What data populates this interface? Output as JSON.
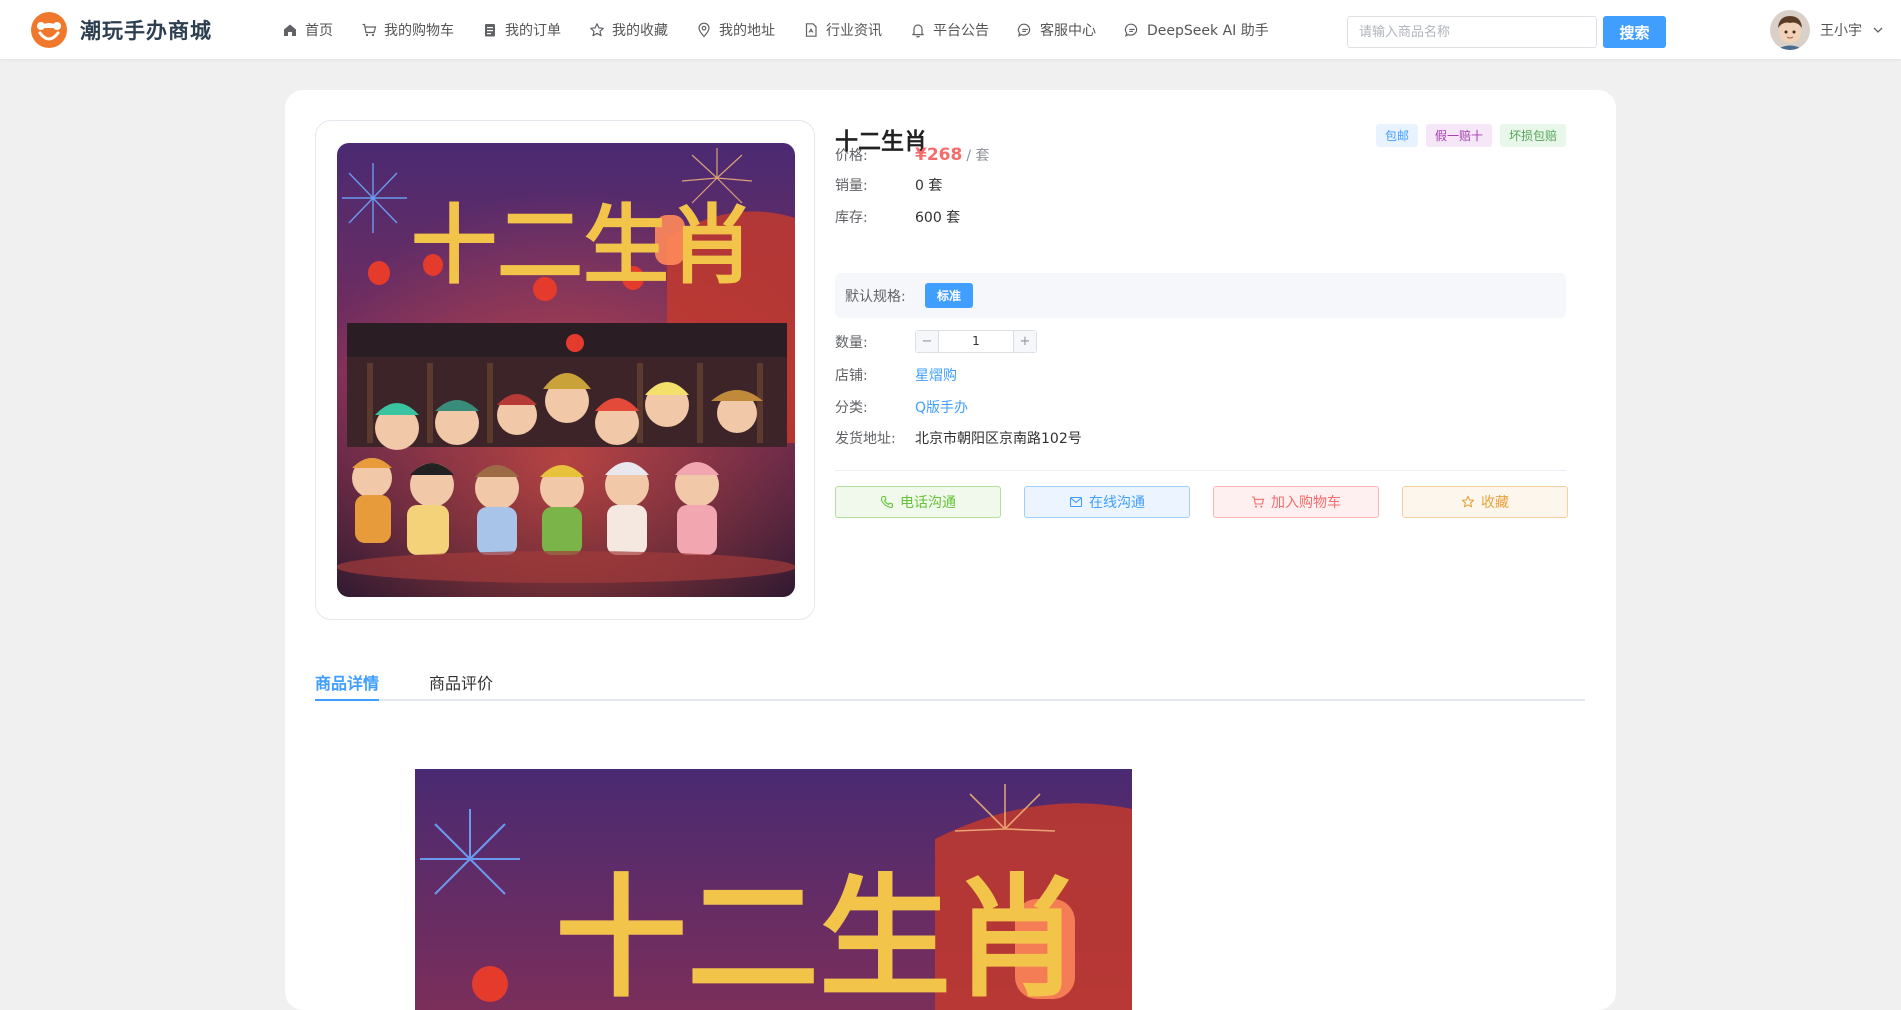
{
  "header": {
    "brand": "潮玩手办商城",
    "nav": [
      {
        "label": "首页",
        "icon": "home-icon"
      },
      {
        "label": "我的购物车",
        "icon": "cart-icon"
      },
      {
        "label": "我的订单",
        "icon": "order-icon"
      },
      {
        "label": "我的收藏",
        "icon": "star-icon"
      },
      {
        "label": "我的地址",
        "icon": "location-icon"
      },
      {
        "label": "行业资讯",
        "icon": "news-icon"
      },
      {
        "label": "平台公告",
        "icon": "bell-icon"
      },
      {
        "label": "客服中心",
        "icon": "chat-icon"
      },
      {
        "label": "DeepSeek AI 助手",
        "icon": "ai-chat-icon"
      }
    ],
    "search": {
      "placeholder": "请输入商品名称",
      "button_label": "搜索"
    },
    "user": {
      "name": "王小宇"
    }
  },
  "product": {
    "title": "十二生肖",
    "image_caption": "十二生肖",
    "tags": [
      "包邮",
      "假一赔十",
      "坏损包赔"
    ],
    "price_label": "价格:",
    "price": "¥268",
    "price_unit": "/ 套",
    "sales_label": "销量:",
    "sales": "0 套",
    "stock_label": "库存:",
    "stock": "600 套",
    "spec_label": "默认规格:",
    "spec_value": "标准",
    "qty_label": "数量:",
    "qty_minus": "−",
    "qty": "1",
    "qty_plus": "+",
    "shop_label": "店铺:",
    "shop": "星熠购",
    "category_label": "分类:",
    "category": "Q版手办",
    "address_label": "发货地址:",
    "address": "北京市朝阳区京南路102号"
  },
  "actions": {
    "phone": "电话沟通",
    "chat": "在线沟通",
    "cart": "加入购物车",
    "favorite": "收藏"
  },
  "tabs": {
    "details": "商品详情",
    "reviews": "商品评价"
  },
  "colors": {
    "accent": "#409eff",
    "price": "#f56c6c",
    "brand_orange": "#f0782d"
  }
}
